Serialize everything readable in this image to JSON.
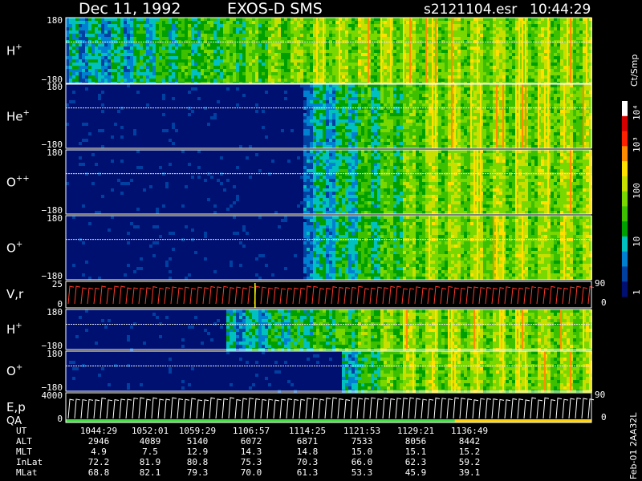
{
  "header": {
    "date": "Dec 11, 1992",
    "instrument": "EXOS-D SMS",
    "file": "s2121104.esr",
    "time": "10:44:29"
  },
  "colorbar": {
    "unit": "Ct/Smp",
    "labels": [
      "10⁴",
      "10³",
      "100",
      "10",
      "1"
    ],
    "colors": [
      "#ffffff",
      "#d40000",
      "#ff2000",
      "#ff8c00",
      "#ffe000",
      "#c8e000",
      "#78d800",
      "#3cc000",
      "#00a000",
      "#00c0c0",
      "#0080d0",
      "#0040a0",
      "#001070"
    ]
  },
  "panels": [
    {
      "label": "H",
      "sup": "+",
      "ytop": "180",
      "ybot": "−180"
    },
    {
      "label": "He",
      "sup": "+",
      "ytop": "180",
      "ybot": "−180"
    },
    {
      "label": "O",
      "sup": "++",
      "ytop": "180",
      "ybot": "−180"
    },
    {
      "label": "O",
      "sup": "+",
      "ytop": "180",
      "ybot": "−180"
    },
    {
      "label": "V,r",
      "sup": "",
      "ytop": "25",
      "ybot": "0",
      "rtop": "90",
      "rbot": "0"
    },
    {
      "label": "H",
      "sup": "+",
      "ytop": "180",
      "ybot": "−180"
    },
    {
      "label": "O",
      "sup": "+",
      "ytop": "180",
      "ybot": "−180"
    },
    {
      "label": "E,p",
      "label2": "QA",
      "sup": "",
      "ytop": "4000",
      "ybot": "0",
      "rtop": "90",
      "rbot": "0"
    }
  ],
  "footer": {
    "row_labels": [
      "UT",
      "ALT",
      "MLT",
      "InLat",
      "MLat"
    ],
    "columns": [
      {
        "UT": "1044:29",
        "ALT": "2946",
        "MLT": "4.9",
        "InLat": "72.2",
        "MLat": "68.8"
      },
      {
        "UT": "1052:01",
        "ALT": "4089",
        "MLT": "7.5",
        "InLat": "81.9",
        "MLat": "82.1"
      },
      {
        "UT": "1059:29",
        "ALT": "5140",
        "MLT": "12.9",
        "InLat": "80.8",
        "MLat": "79.3"
      },
      {
        "UT": "1106:57",
        "ALT": "6072",
        "MLT": "14.3",
        "InLat": "75.3",
        "MLat": "70.0"
      },
      {
        "UT": "1114:25",
        "ALT": "6871",
        "MLT": "14.8",
        "InLat": "70.3",
        "MLat": "61.3"
      },
      {
        "UT": "1121:53",
        "ALT": "7533",
        "MLT": "15.0",
        "InLat": "66.0",
        "MLat": "53.3"
      },
      {
        "UT": "1129:21",
        "ALT": "8056",
        "MLT": "15.1",
        "InLat": "62.3",
        "MLat": "45.9"
      },
      {
        "UT": "1136:49",
        "ALT": "8442",
        "MLT": "15.2",
        "InLat": "59.2",
        "MLat": "39.1"
      }
    ],
    "side_text": "Feb-01 2AA32L"
  },
  "chart_data": {
    "type": "heatmap",
    "title": "Dec 11, 1992   EXOS-D SMS",
    "xlabel": "UT",
    "x_ticks": [
      "1044:29",
      "1052:01",
      "1059:29",
      "1106:57",
      "1114:25",
      "1121:53",
      "1129:21",
      "1136:49"
    ],
    "series": [
      {
        "name": "H+",
        "ylim": [
          -180,
          180
        ],
        "onset_fraction": 0.0,
        "intense_fraction": 0.45
      },
      {
        "name": "He+",
        "ylim": [
          -180,
          180
        ],
        "onset_fraction": 0.45,
        "intense_fraction": 0.69
      },
      {
        "name": "O++",
        "ylim": [
          -180,
          180
        ],
        "onset_fraction": 0.45,
        "intense_fraction": 0.69
      },
      {
        "name": "O+",
        "ylim": [
          -180,
          180
        ],
        "onset_fraction": 0.45,
        "intense_fraction": 0.69
      },
      {
        "name": "V,r",
        "ylim": [
          0,
          25
        ],
        "ylim_right": [
          0,
          90
        ]
      },
      {
        "name": "H+",
        "ylim": [
          -180,
          180
        ],
        "onset_fraction": 0.3,
        "intense_fraction": 0.62
      },
      {
        "name": "O+",
        "ylim": [
          -180,
          180
        ],
        "onset_fraction": 0.52,
        "intense_fraction": 0.63
      },
      {
        "name": "E,p",
        "ylim": [
          0,
          4000
        ],
        "ylim_right": [
          0,
          90
        ]
      }
    ],
    "colorbar_range": [
      1,
      10000
    ],
    "colorbar_scale": "log"
  }
}
